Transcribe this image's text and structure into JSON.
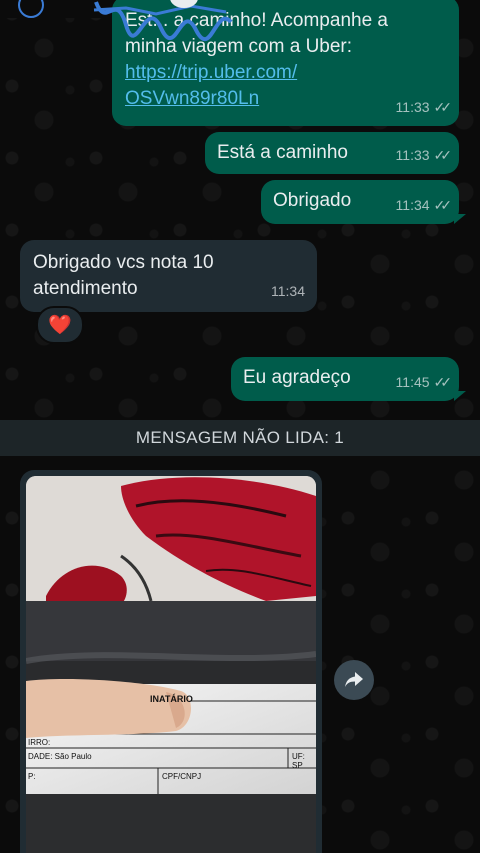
{
  "messages": [
    {
      "id": "uber-share",
      "direction": "outgoing",
      "text": "Estou a caminho! Acompanhe a minha viagem com a Uber:",
      "link": "https://trip.uber.com/OSVwn89r80Ln",
      "visible_lines": [
        "Est... a caminho! Acompanhe a",
        "minha viagem com a Uber:"
      ],
      "link_lines": [
        "https://trip.uber.com/",
        "OSVwn89r80Ln"
      ],
      "time": "11:33",
      "status": "read"
    },
    {
      "id": "esta-caminho",
      "direction": "outgoing",
      "text": "Está a caminho",
      "time": "11:33",
      "status": "read"
    },
    {
      "id": "obrigado-out",
      "direction": "outgoing",
      "text": "Obrigado",
      "time": "11:34",
      "status": "read"
    },
    {
      "id": "obrigado-in",
      "direction": "incoming",
      "lines": [
        "Obrigado vcs nota 10",
        "atendimento"
      ],
      "time": "11:34",
      "reaction": "❤️"
    },
    {
      "id": "agradeco",
      "direction": "outgoing",
      "text": "Eu agradeço",
      "time": "11:45",
      "status": "read"
    }
  ],
  "unread_banner": "MENSAGEM NÃO LIDA: 1",
  "photo_message": {
    "label_lines": {
      "destinatario": "INATÁRIO",
      "bairro": "IRRO:",
      "cidade": "DADE: São Paulo",
      "uf": "UF: SP",
      "cep": "P:",
      "cpf": "CPF/CNPJ"
    }
  },
  "icons": {
    "read_ticks": "double-check-icon",
    "forward": "forward-arrow-icon"
  },
  "colors": {
    "outgoing_bubble": "#005c4b",
    "incoming_bubble": "#202c33",
    "link": "#53bdeb",
    "background": "#0b0b0b"
  }
}
